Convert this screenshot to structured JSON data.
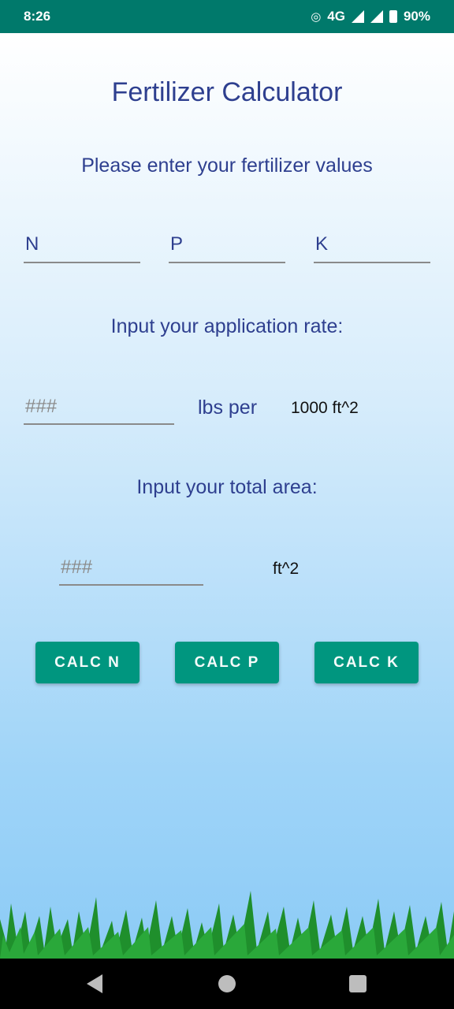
{
  "status": {
    "time": "8:26",
    "network": "4G",
    "battery": "90%"
  },
  "app": {
    "title": "Fertilizer Calculator",
    "prompt": "Please enter your fertilizer values",
    "npk": {
      "n_placeholder": "N",
      "p_placeholder": "P",
      "k_placeholder": "K"
    },
    "rate_prompt": "Input your application rate:",
    "rate": {
      "placeholder": "###",
      "unit_label": "lbs per",
      "unit_value": "1000 ft^2"
    },
    "area_prompt": "Input your total area:",
    "area": {
      "placeholder": "###",
      "unit": "ft^2"
    },
    "buttons": {
      "calc_n": "CALC N",
      "calc_p": "CALC P",
      "calc_k": "CALC K"
    }
  },
  "colors": {
    "status_bar": "#00796b",
    "accent": "#00967f",
    "heading": "#2e3f8f",
    "grass": "#1f8f2c"
  },
  "icons": {
    "nav_back": "triangle-back-icon",
    "nav_home": "circle-home-icon",
    "nav_recent": "square-recent-icon"
  }
}
